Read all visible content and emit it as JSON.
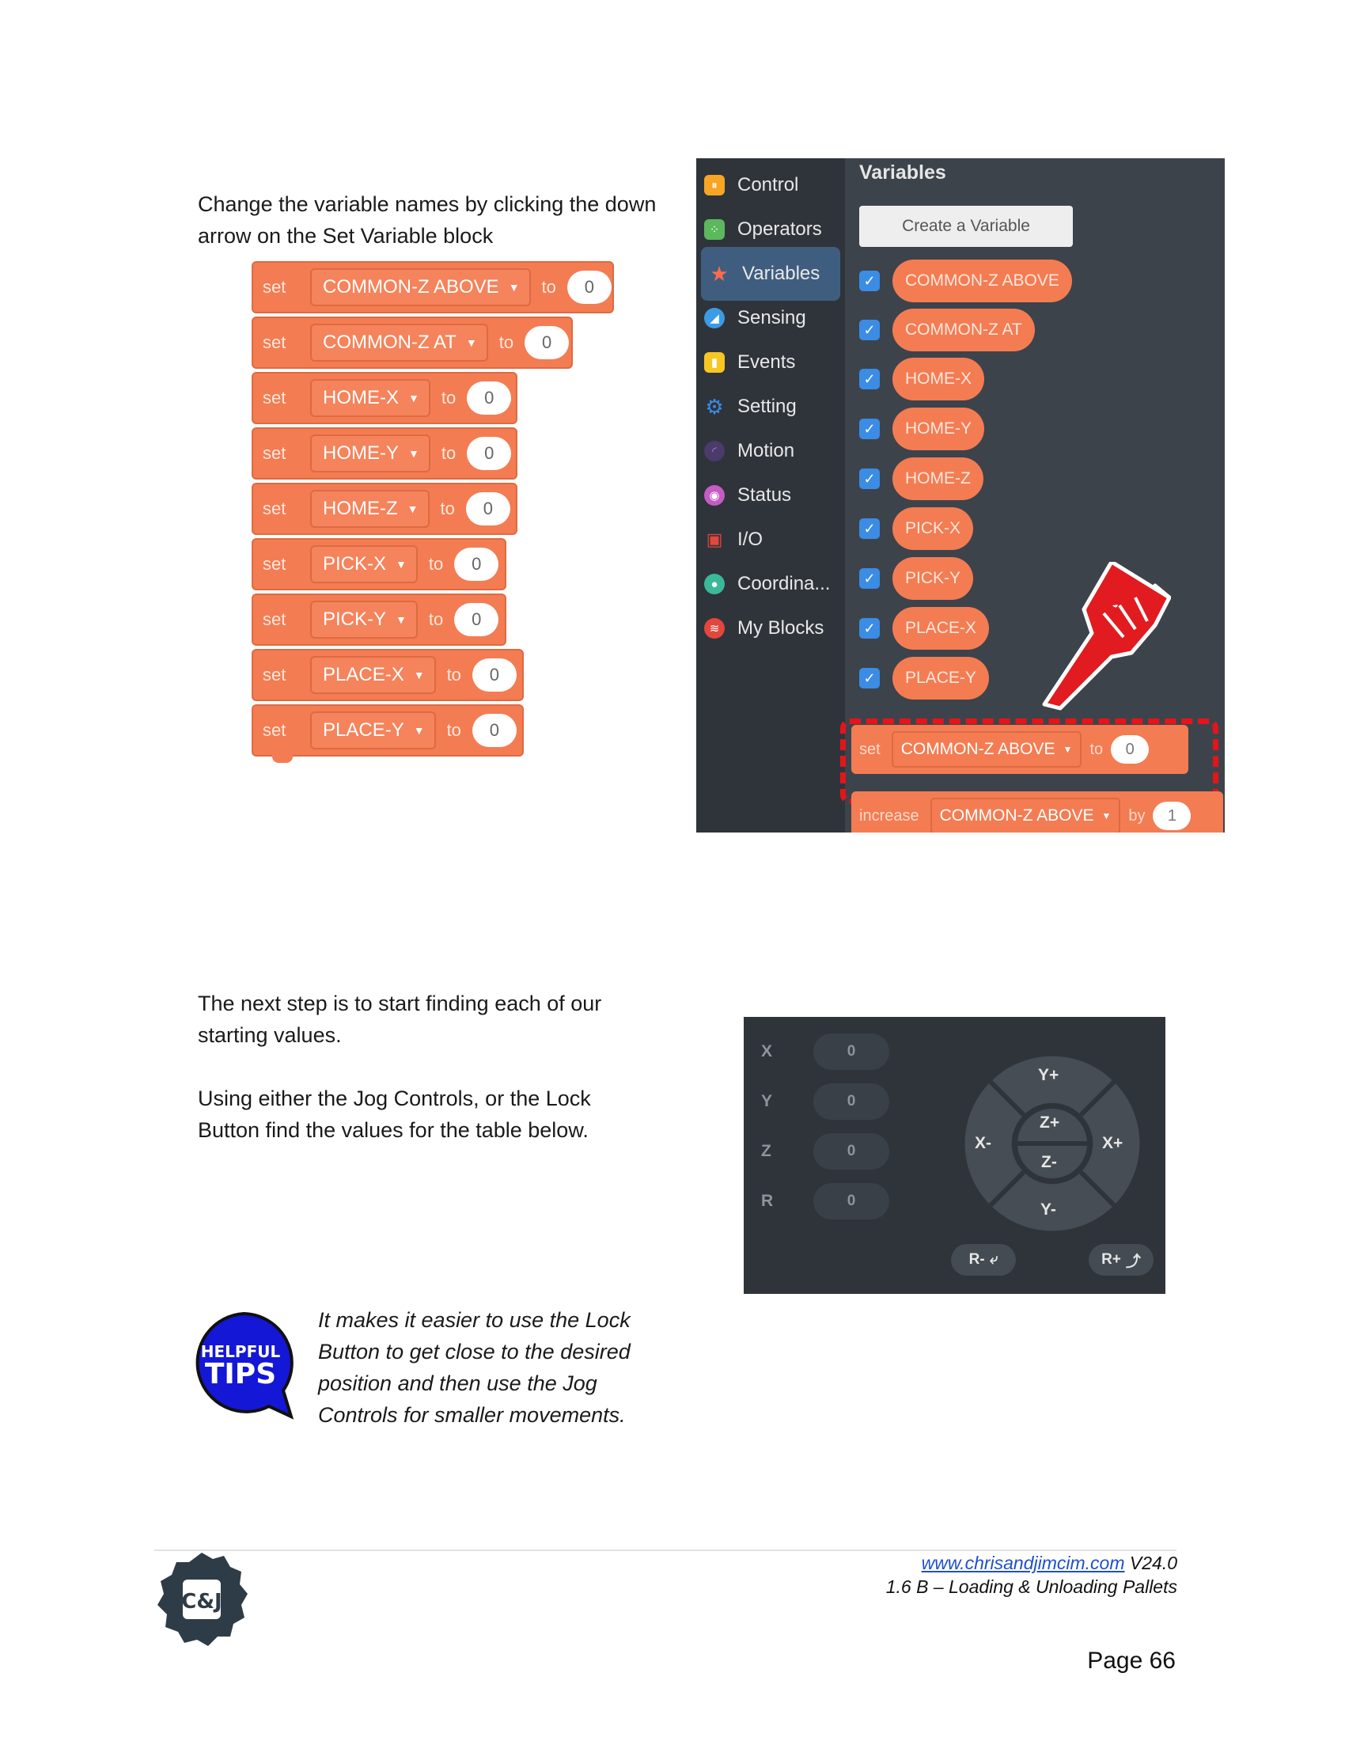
{
  "intro": {
    "line1": "Change the variable names by clicking the down",
    "line2": "arrow on the Set Variable block"
  },
  "set_blocks": [
    {
      "keyword": "set",
      "variable": "COMMON-Z ABOVE",
      "to": "to",
      "value": "0"
    },
    {
      "keyword": "set",
      "variable": "COMMON-Z AT",
      "to": "to",
      "value": "0"
    },
    {
      "keyword": "set",
      "variable": "HOME-X",
      "to": "to",
      "value": "0"
    },
    {
      "keyword": "set",
      "variable": "HOME-Y",
      "to": "to",
      "value": "0"
    },
    {
      "keyword": "set",
      "variable": "HOME-Z",
      "to": "to",
      "value": "0"
    },
    {
      "keyword": "set",
      "variable": "PICK-X",
      "to": "to",
      "value": "0"
    },
    {
      "keyword": "set",
      "variable": "PICK-Y",
      "to": "to",
      "value": "0"
    },
    {
      "keyword": "set",
      "variable": "PLACE-X",
      "to": "to",
      "value": "0"
    },
    {
      "keyword": "set",
      "variable": "PLACE-Y",
      "to": "to",
      "value": "0"
    }
  ],
  "editor": {
    "categories": [
      "Control",
      "Operators",
      "Variables",
      "Sensing",
      "Events",
      "Setting",
      "Motion",
      "Status",
      "I/O",
      "Coordina...",
      "My Blocks"
    ],
    "category_colors": [
      "#f6a623",
      "#5cb85c",
      "#ff6b4a",
      "#3b9be4",
      "#f6c623",
      "#3b8ce4",
      "#8a5cc4",
      "#c45cc4",
      "#e4463b",
      "#3bb89a",
      "#e4463b"
    ],
    "active_category": "Variables",
    "palette_title": "Variables",
    "create_button": "Create a Variable",
    "variables": [
      "COMMON-Z ABOVE",
      "COMMON-Z AT",
      "HOME-X",
      "HOME-Y",
      "HOME-Z",
      "PICK-X",
      "PICK-Y",
      "PLACE-X",
      "PLACE-Y"
    ],
    "highlight_block": {
      "keyword": "set",
      "variable": "COMMON-Z ABOVE",
      "to": "to",
      "value": "0"
    },
    "increase_block": {
      "keyword": "increase",
      "variable": "COMMON-Z ABOVE",
      "by": "by",
      "value": "1"
    }
  },
  "next_step": {
    "line1": "The next step is to start finding each of our",
    "line2": "starting values.",
    "line3": "Using either the Jog Controls, or the Lock",
    "line4": "Button find the values for the table below."
  },
  "jog": {
    "coords": [
      {
        "axis": "X",
        "value": "0"
      },
      {
        "axis": "Y",
        "value": "0"
      },
      {
        "axis": "Z",
        "value": "0"
      },
      {
        "axis": "R",
        "value": "0"
      }
    ],
    "y_plus": "Y+",
    "y_minus": "Y-",
    "x_minus": "X-",
    "x_plus": "X+",
    "z_plus": "Z+",
    "z_minus": "Z-",
    "r_minus": "R-",
    "r_plus": "R+"
  },
  "tips": {
    "badge_top": "HELPFUL",
    "badge_bottom": "TIPS",
    "line1": "It makes it easier to use the Lock",
    "line2": "Button to get close to the desired",
    "line3": "position and then use the Jog",
    "line4": "Controls for smaller movements."
  },
  "footer": {
    "url": "www.chrisandjimcim.com",
    "version": "V24.0",
    "subtitle": "1.6 B – Loading & Unloading Pallets",
    "page": "Page 66",
    "logo_text": "C&J"
  },
  "colors": {
    "block": "#f47c52",
    "dashed_highlight": "#e4141b",
    "editor_bg": "#3d434b",
    "jog_bg": "#2f343b",
    "badge_blue": "#1417d6"
  }
}
